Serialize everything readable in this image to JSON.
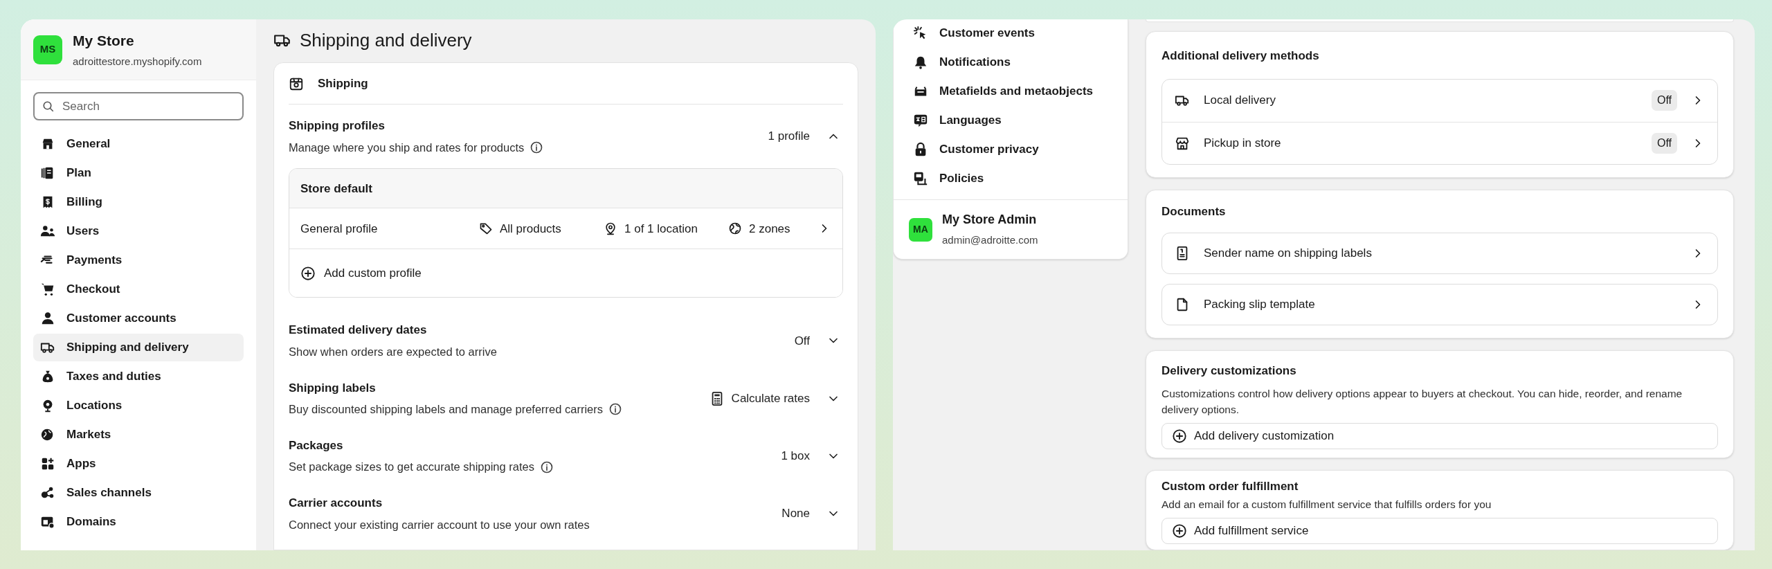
{
  "left_panel": {
    "sidebar": {
      "store": {
        "initials": "MS",
        "name": "My Store",
        "domain": "adroittestore.myshopify.com"
      },
      "search": {
        "placeholder": "Search"
      },
      "items": [
        {
          "label": "General",
          "selected": false
        },
        {
          "label": "Plan",
          "selected": false
        },
        {
          "label": "Billing",
          "selected": false
        },
        {
          "label": "Users",
          "selected": false
        },
        {
          "label": "Payments",
          "selected": false
        },
        {
          "label": "Checkout",
          "selected": false
        },
        {
          "label": "Customer accounts",
          "selected": false
        },
        {
          "label": "Shipping and delivery",
          "selected": true
        },
        {
          "label": "Taxes and duties",
          "selected": false
        },
        {
          "label": "Locations",
          "selected": false
        },
        {
          "label": "Markets",
          "selected": false
        },
        {
          "label": "Apps",
          "selected": false
        },
        {
          "label": "Sales channels",
          "selected": false
        },
        {
          "label": "Domains",
          "selected": false
        }
      ]
    },
    "page": {
      "title": "Shipping and delivery",
      "card": {
        "title": "Shipping",
        "profiles": {
          "title": "Shipping profiles",
          "description": "Manage where you ship and rates for products",
          "info": true,
          "value": "1 profile",
          "expanded": true,
          "group": {
            "title": "Store default",
            "row": {
              "name": "General profile",
              "products": "All products",
              "locations": "1 of 1 location",
              "zones": "2 zones"
            },
            "add": "Add custom profile"
          }
        },
        "settings": [
          {
            "title": "Estimated delivery dates",
            "description": "Show when orders are expected to arrive",
            "info": false,
            "value": "Off",
            "expanded": false
          },
          {
            "title": "Shipping labels",
            "description": "Buy discounted shipping labels and manage preferred carriers",
            "info": true,
            "value": "Calculate rates",
            "expanded": false
          },
          {
            "title": "Packages",
            "description": "Set package sizes to get accurate shipping rates",
            "info": true,
            "value": "1 box",
            "expanded": false
          },
          {
            "title": "Carrier accounts",
            "description": "Connect your existing carrier account to use your own rates",
            "info": false,
            "value": "None",
            "expanded": false
          }
        ]
      }
    }
  },
  "right_panel": {
    "sidebar": {
      "items": [
        {
          "label": "Customer events",
          "selected": false
        },
        {
          "label": "Notifications",
          "selected": false
        },
        {
          "label": "Metafields and metaobjects",
          "selected": false
        },
        {
          "label": "Languages",
          "selected": false
        },
        {
          "label": "Customer privacy",
          "selected": false
        },
        {
          "label": "Policies",
          "selected": false
        }
      ],
      "account": {
        "initials": "MA",
        "name": "My Store Admin",
        "email": "admin@adroitte.com"
      }
    },
    "delivery_methods": {
      "title": "Additional delivery methods",
      "items": [
        {
          "label": "Local delivery",
          "status": "Off"
        },
        {
          "label": "Pickup in store",
          "status": "Off"
        }
      ]
    },
    "documents": {
      "title": "Documents",
      "items": [
        {
          "label": "Sender name on shipping labels"
        },
        {
          "label": "Packing slip template"
        }
      ]
    },
    "delivery_customizations": {
      "title": "Delivery customizations",
      "description": "Customizations control how delivery options appear to buyers at checkout.  You can hide, reorder, and rename delivery options.",
      "button": "Add delivery customization"
    },
    "custom_fulfillment": {
      "title": "Custom order fulfillment",
      "description": "Add an email for a custom fulfillment service that fulfills orders for you",
      "button": "Add fulfillment service"
    }
  }
}
